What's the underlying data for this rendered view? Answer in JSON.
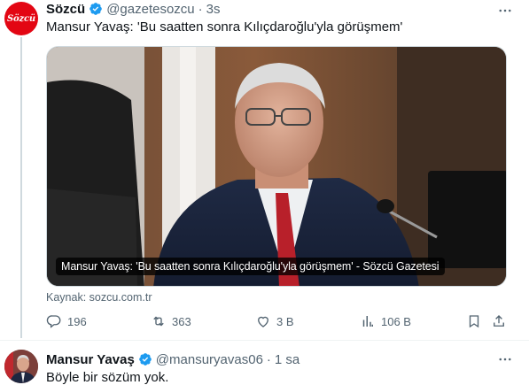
{
  "tweet1": {
    "author_name": "Sözcü",
    "avatar_text": "Sözcü",
    "handle": "@gazetesozcu",
    "separator": "·",
    "time": "3s",
    "text": "Mansur Yavaş: 'Bu saatten sonra Kılıçdaroğlu'yla görüşmem'",
    "card_caption": "Mansur Yavaş: 'Bu saatten sonra Kılıçdaroğlu'yla görüşmem' - Sözcü Gazetesi",
    "source": "Kaynak: sozcu.com.tr",
    "actions": {
      "replies": "196",
      "reposts": "363",
      "likes": "3 B",
      "views": "106 B"
    }
  },
  "tweet2": {
    "author_name": "Mansur Yavaş",
    "handle": "@mansuryavas06",
    "separator": "·",
    "time": "1 sa",
    "text": "Böyle bir sözüm yok."
  },
  "icons": {
    "verified": "verified-badge-icon",
    "more": "more-horizontal-icon",
    "reply": "reply-icon",
    "repost": "repost-icon",
    "like": "heart-icon",
    "views": "views-icon",
    "bookmark": "bookmark-icon",
    "share": "share-icon"
  },
  "colors": {
    "brand_red": "#e30613",
    "verified_blue": "#1d9bf0",
    "muted_text": "#536471"
  }
}
